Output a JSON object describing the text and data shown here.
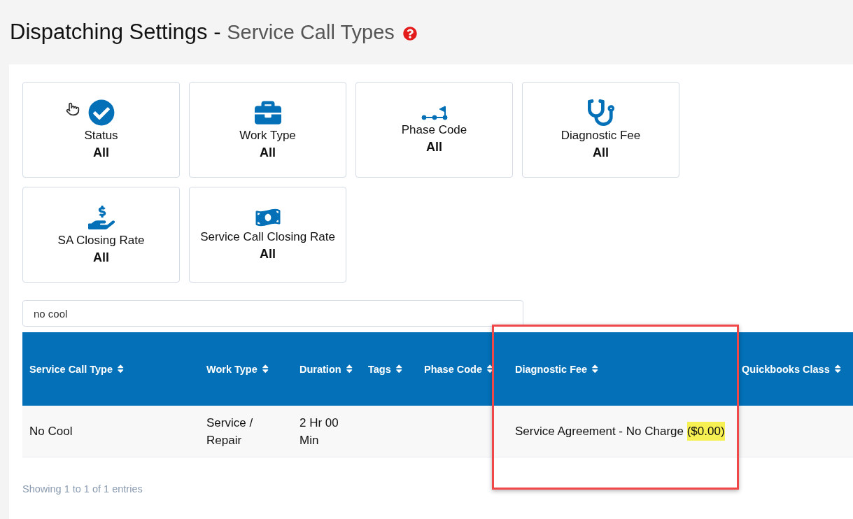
{
  "page_title": {
    "main": "Dispatching Settings - ",
    "sub": "Service Call Types"
  },
  "filter_cards": [
    {
      "label": "Status",
      "value": "All"
    },
    {
      "label": "Work Type",
      "value": "All"
    },
    {
      "label": "Phase Code",
      "value": "All"
    },
    {
      "label": "Diagnostic Fee",
      "value": "All"
    },
    {
      "label": "SA Closing Rate",
      "value": "All"
    },
    {
      "label": "Service Call Closing Rate",
      "value": "All"
    }
  ],
  "search": {
    "value": "no cool"
  },
  "table": {
    "columns": [
      "Service Call Type",
      "Work Type",
      "Duration",
      "Tags",
      "Phase Code",
      "Diagnostic Fee",
      "Quickbooks Class"
    ],
    "rows": [
      {
        "service_call_type": "No Cool",
        "work_type": "Service / Repair",
        "duration": "2 Hr 00 Min",
        "diagnostic_fee": {
          "text": "Service Agreement - No Charge",
          "amount": "($0.00)",
          "highlighted": true
        }
      }
    ]
  },
  "footer": "Showing 1 to 1 of 1 entries",
  "annotation_box": true
}
